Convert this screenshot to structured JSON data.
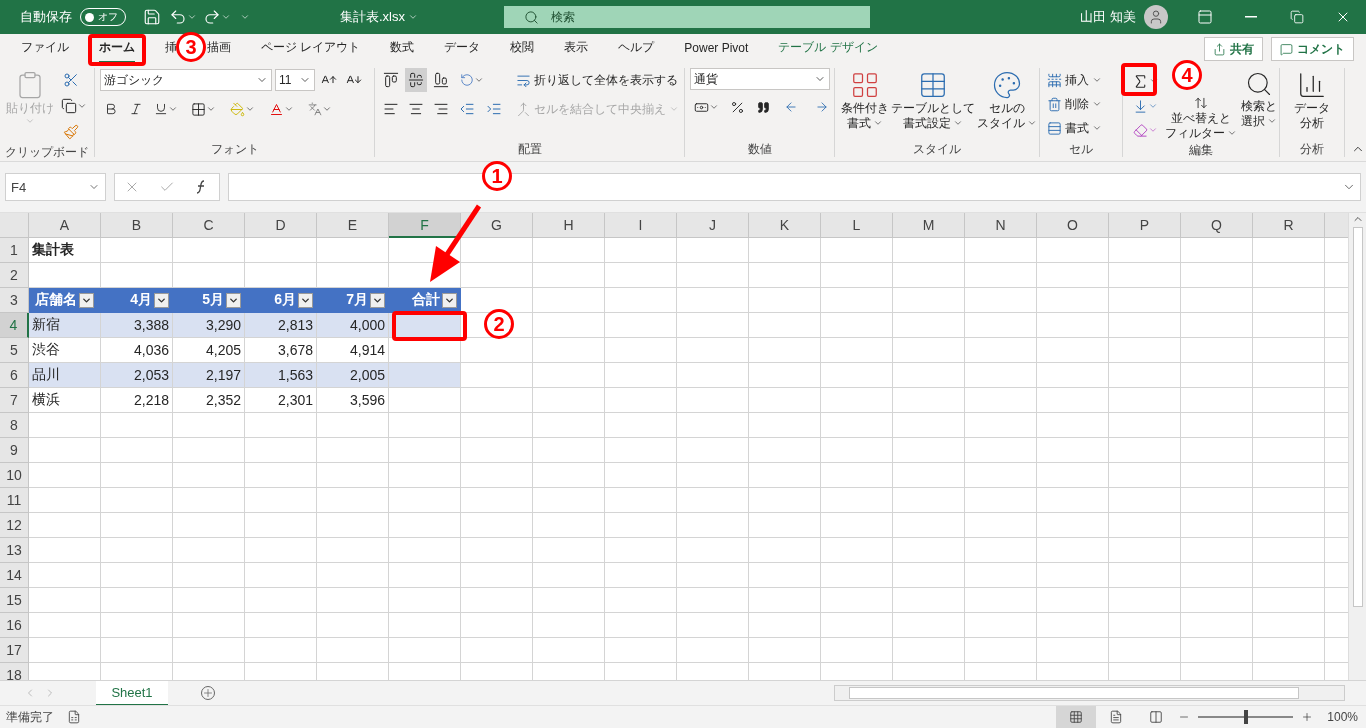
{
  "title_bar": {
    "autosave_label": "自動保存",
    "autosave": {
      "label": "オフ",
      "on": false
    },
    "file_name": "集計表.xlsx",
    "search_placeholder": "検索",
    "user_name": "山田 知美"
  },
  "ribbon_tabs": [
    {
      "label": "ファイル",
      "selected": false,
      "kind": "normal"
    },
    {
      "label": "ホーム",
      "selected": true,
      "kind": "normal"
    },
    {
      "label": "挿",
      "selected": false,
      "kind": "normal"
    },
    {
      "label": "描画",
      "selected": false,
      "kind": "normal"
    },
    {
      "label": "ページ レイアウト",
      "selected": false,
      "kind": "normal"
    },
    {
      "label": "数式",
      "selected": false,
      "kind": "normal"
    },
    {
      "label": "データ",
      "selected": false,
      "kind": "normal"
    },
    {
      "label": "校閲",
      "selected": false,
      "kind": "normal"
    },
    {
      "label": "表示",
      "selected": false,
      "kind": "normal"
    },
    {
      "label": "ヘルプ",
      "selected": false,
      "kind": "normal"
    },
    {
      "label": "Power Pivot",
      "selected": false,
      "kind": "normal"
    },
    {
      "label": "テーブル デザイン",
      "selected": false,
      "kind": "contextual"
    }
  ],
  "share_button": "共有",
  "comment_button": "コメント",
  "ribbon": {
    "clipboard": {
      "paste": {
        "label": "貼り付け",
        "disabled": true
      },
      "group": "クリップボード"
    },
    "font": {
      "name": "游ゴシック",
      "size": "11",
      "group": "フォント"
    },
    "alignment": {
      "wrap": "折り返して全体を表示する",
      "merge": {
        "label": "セルを結合して中央揃え",
        "disabled": true
      },
      "group": "配置"
    },
    "number": {
      "format": "通貨",
      "group": "数値"
    },
    "styles": {
      "buttons": [
        {
          "lines": [
            "条件付き",
            "書式"
          ]
        },
        {
          "lines": [
            "テーブルとして",
            "書式設定"
          ]
        },
        {
          "lines": [
            "セルの",
            "スタイル"
          ]
        }
      ],
      "group": "スタイル"
    },
    "cells": {
      "buttons": [
        "挿入",
        "削除",
        "書式"
      ],
      "group": "セル"
    },
    "editing": {
      "sort": [
        "並べ替えと",
        "フィルター"
      ],
      "find": [
        "検索と",
        "選択"
      ],
      "group": "編集"
    },
    "analysis": {
      "button": [
        "データ",
        "分析"
      ],
      "group": "分析"
    }
  },
  "formula_bar": {
    "name_box": "F4"
  },
  "sheet": {
    "columns": [
      {
        "label": "A",
        "selected": false
      },
      {
        "label": "B",
        "selected": false
      },
      {
        "label": "C",
        "selected": false
      },
      {
        "label": "D",
        "selected": false
      },
      {
        "label": "E",
        "selected": false
      },
      {
        "label": "F",
        "selected": true
      },
      {
        "label": "G",
        "selected": false
      },
      {
        "label": "H",
        "selected": false
      },
      {
        "label": "I",
        "selected": false
      },
      {
        "label": "J",
        "selected": false
      },
      {
        "label": "K",
        "selected": false
      },
      {
        "label": "L",
        "selected": false
      },
      {
        "label": "M",
        "selected": false
      },
      {
        "label": "N",
        "selected": false
      },
      {
        "label": "O",
        "selected": false
      },
      {
        "label": "P",
        "selected": false
      },
      {
        "label": "Q",
        "selected": false
      },
      {
        "label": "R",
        "selected": false
      }
    ],
    "rows": [
      {
        "label": "1",
        "selected": false
      },
      {
        "label": "2",
        "selected": false
      },
      {
        "label": "3",
        "selected": false
      },
      {
        "label": "4",
        "selected": true
      },
      {
        "label": "5",
        "selected": false
      },
      {
        "label": "6",
        "selected": false
      },
      {
        "label": "7",
        "selected": false
      },
      {
        "label": "8",
        "selected": false
      },
      {
        "label": "9",
        "selected": false
      },
      {
        "label": "10",
        "selected": false
      },
      {
        "label": "11",
        "selected": false
      },
      {
        "label": "12",
        "selected": false
      },
      {
        "label": "13",
        "selected": false
      },
      {
        "label": "14",
        "selected": false
      },
      {
        "label": "15",
        "selected": false
      },
      {
        "label": "16",
        "selected": false
      },
      {
        "label": "17",
        "selected": false
      },
      {
        "label": "18",
        "selected": false
      }
    ],
    "title_cell": "集計表",
    "table": {
      "headers": [
        "店舗名",
        "4月",
        "5月",
        "6月",
        "7月",
        "合計"
      ],
      "rows": [
        {
          "cells": [
            "新宿",
            "3,388",
            "3,290",
            "2,813",
            "4,000"
          ],
          "banded": true
        },
        {
          "cells": [
            "渋谷",
            "4,036",
            "4,205",
            "3,678",
            "4,914"
          ],
          "banded": false
        },
        {
          "cells": [
            "品川",
            "2,053",
            "2,197",
            "1,563",
            "2,005"
          ],
          "banded": true
        },
        {
          "cells": [
            "横浜",
            "2,218",
            "2,352",
            "2,301",
            "3,596"
          ],
          "banded": false
        }
      ]
    }
  },
  "sheet_tabs": [
    {
      "label": "Sheet1",
      "selected": true
    }
  ],
  "status_bar": {
    "status": "準備完了",
    "zoom": {
      "level": 0.5,
      "label": "100%"
    }
  },
  "annotations": [
    {
      "label": "1"
    },
    {
      "label": "2"
    },
    {
      "label": "3"
    },
    {
      "label": "4"
    }
  ]
}
